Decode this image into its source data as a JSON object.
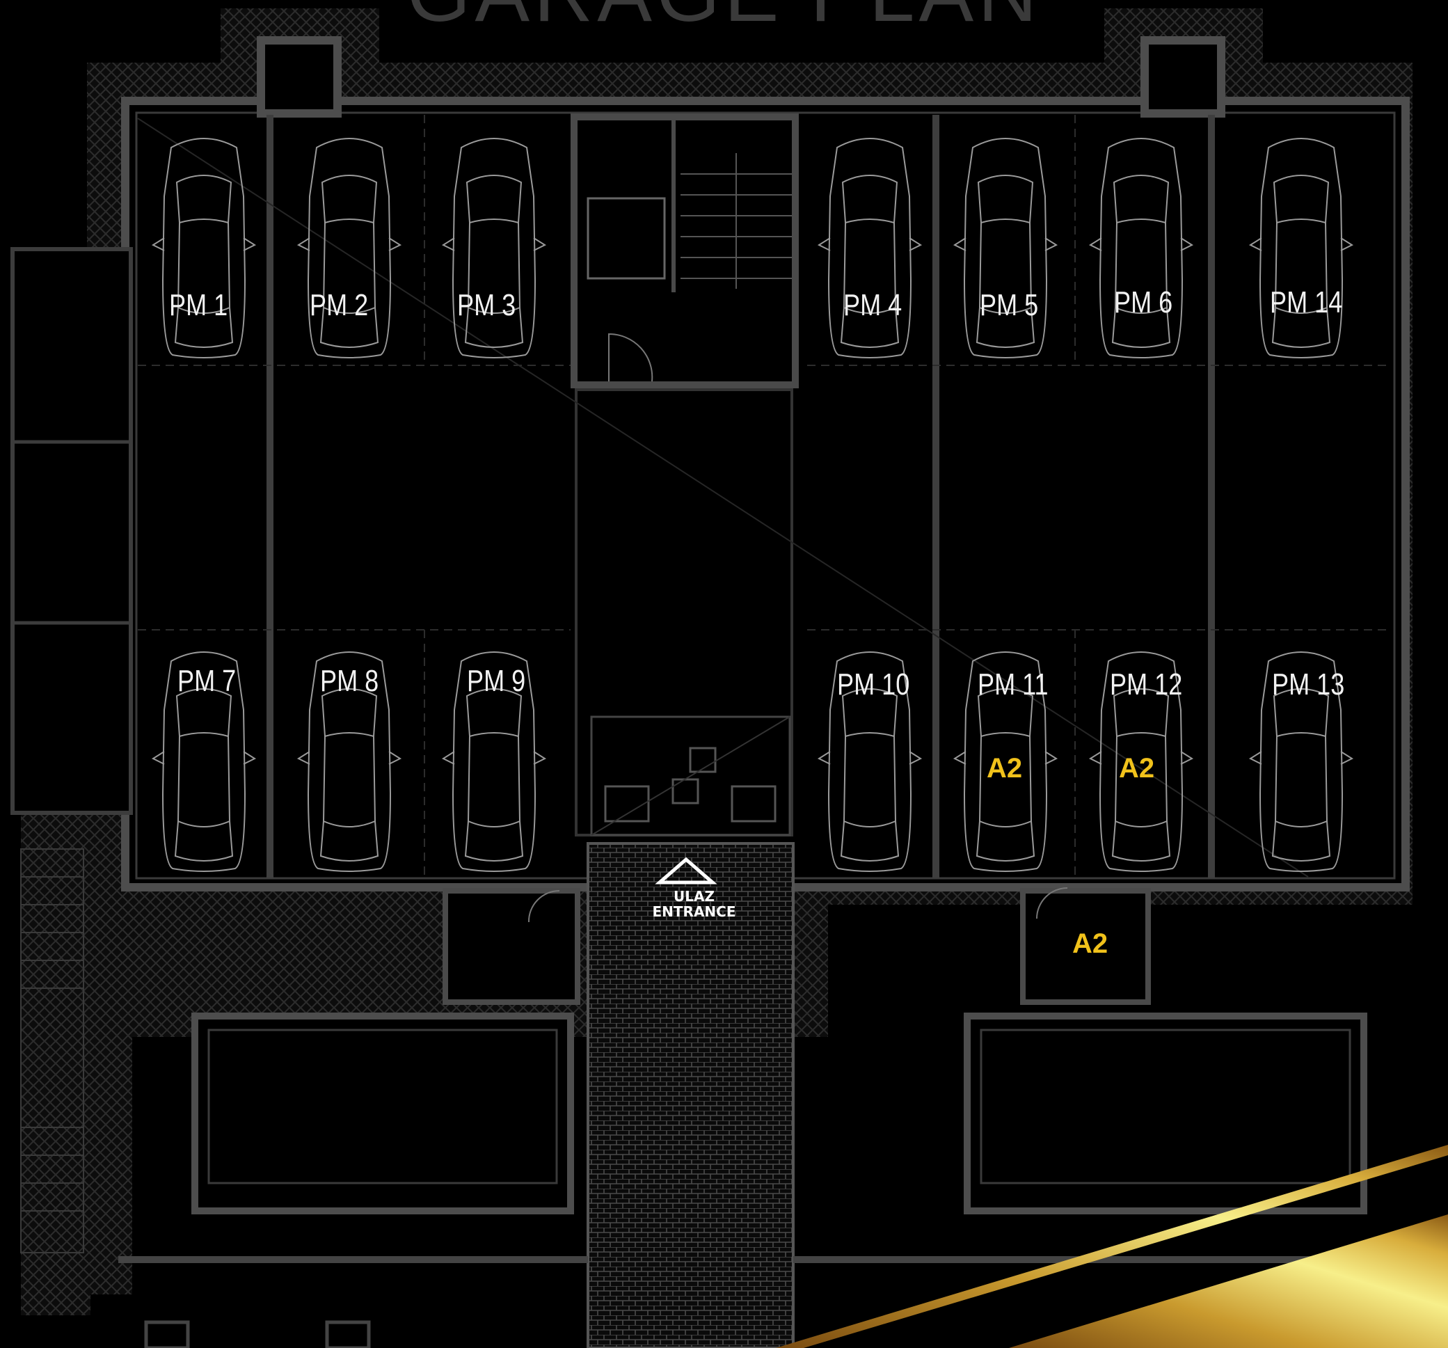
{
  "title": "GARAGE PLAN",
  "spaces": [
    "PM 1",
    "PM 2",
    "PM 3",
    "PM 4",
    "PM 5",
    "PM 6",
    "PM 14",
    "PM 7",
    "PM 8",
    "PM 9",
    "PM 10",
    "PM 11",
    "PM 12",
    "PM 13"
  ],
  "apartment_tag": "A2",
  "entrance": {
    "line1": "ULAZ",
    "line2": "ENTRANCE"
  },
  "colors": {
    "walls": "#4a4a4a",
    "labels": "#f2f2f2",
    "accent": "#f1c21b",
    "gold": "#c99a2e"
  }
}
